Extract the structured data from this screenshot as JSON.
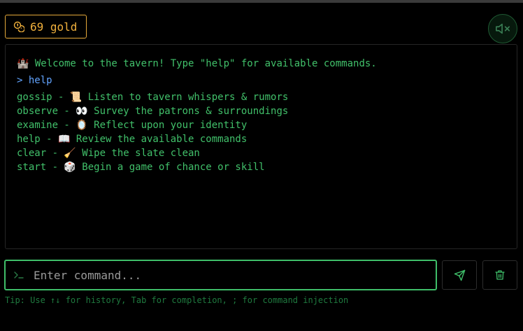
{
  "wallet": {
    "amount_text": "69 gold",
    "icon": "coins-icon",
    "color": "#f0b03c"
  },
  "sound": {
    "icon": "volume-mute-icon",
    "muted": true
  },
  "terminal": {
    "welcome": "🏰 Welcome to the tavern! Type \"help\" for available commands.",
    "echo": "> help",
    "lines": [
      "gossip - 📜 Listen to tavern whispers & rumors",
      "observe - 👀 Survey the patrons & surroundings",
      "examine - 🪞 Reflect upon your identity",
      "help - 📖 Review the available commands",
      "clear - 🧹 Wipe the slate clean",
      "start - 🎲 Begin a game of chance or skill"
    ]
  },
  "command": {
    "placeholder": "Enter command...",
    "value": "",
    "prompt_icon": "terminal-prompt-icon"
  },
  "actions": {
    "send_icon": "send-icon",
    "clear_icon": "trash-icon"
  },
  "tip": "Tip: Use ↑↓ for history, Tab for completion, ; for command injection",
  "colors": {
    "accent": "#41c06a",
    "gold": "#f0b03c",
    "echo": "#62a4ff",
    "background": "#000000"
  }
}
